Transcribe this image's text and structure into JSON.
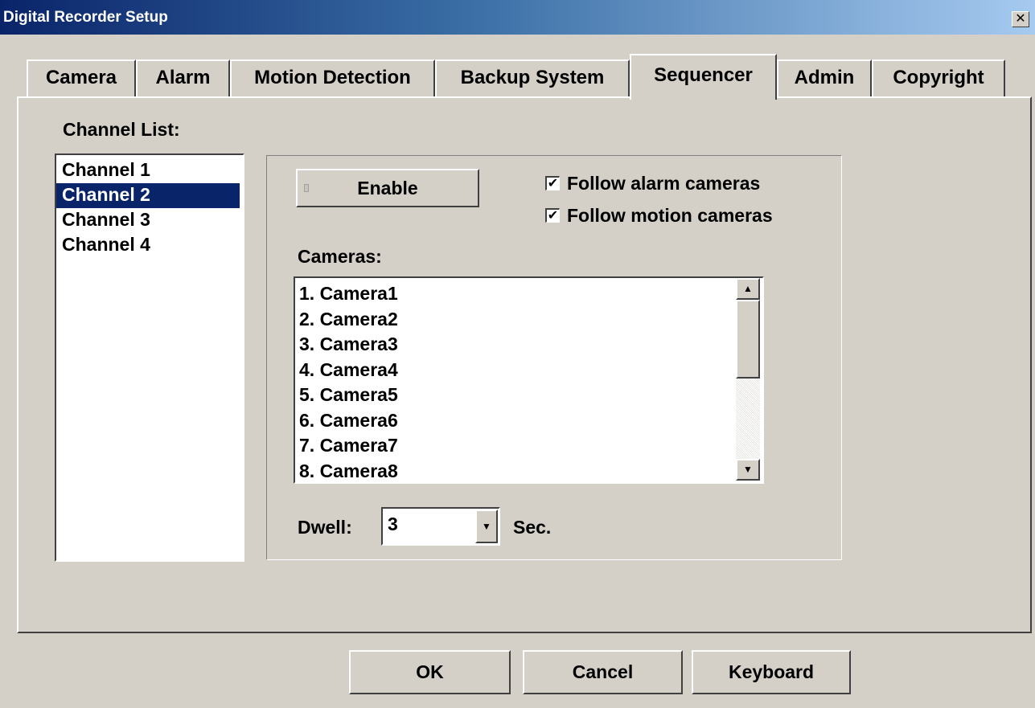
{
  "window": {
    "title": "Digital Recorder Setup",
    "close_glyph": "✕"
  },
  "tabs": [
    {
      "label": "Camera"
    },
    {
      "label": "Alarm"
    },
    {
      "label": "Motion Detection"
    },
    {
      "label": "Backup System"
    },
    {
      "label": "Sequencer",
      "active": true
    },
    {
      "label": "Admin"
    },
    {
      "label": "Copyright"
    }
  ],
  "channel_list": {
    "label": "Channel List:",
    "items": [
      "Channel 1",
      "Channel 2",
      "Channel 3",
      "Channel 4"
    ],
    "selected": "Channel 2"
  },
  "sequencer": {
    "enable_label": "Enable",
    "follow_alarm": {
      "label": "Follow alarm cameras",
      "checked": true
    },
    "follow_motion": {
      "label": "Follow motion cameras",
      "checked": true
    },
    "cameras_label": "Cameras:",
    "cameras": [
      "1. Camera1",
      "2. Camera2",
      "3. Camera3",
      "4. Camera4",
      "5. Camera5",
      "6. Camera6",
      "7. Camera7",
      "8. Camera8"
    ],
    "dwell_label": "Dwell:",
    "dwell_value": "3",
    "dwell_unit": "Sec."
  },
  "glyphs": {
    "check": "✔",
    "arrow_up": "▲",
    "arrow_down": "▼"
  },
  "buttons": {
    "ok": "OK",
    "cancel": "Cancel",
    "keyboard": "Keyboard"
  },
  "colors": {
    "selection": "#0a246a",
    "titlebar_start": "#0a246a",
    "face": "#d4d0c8"
  }
}
